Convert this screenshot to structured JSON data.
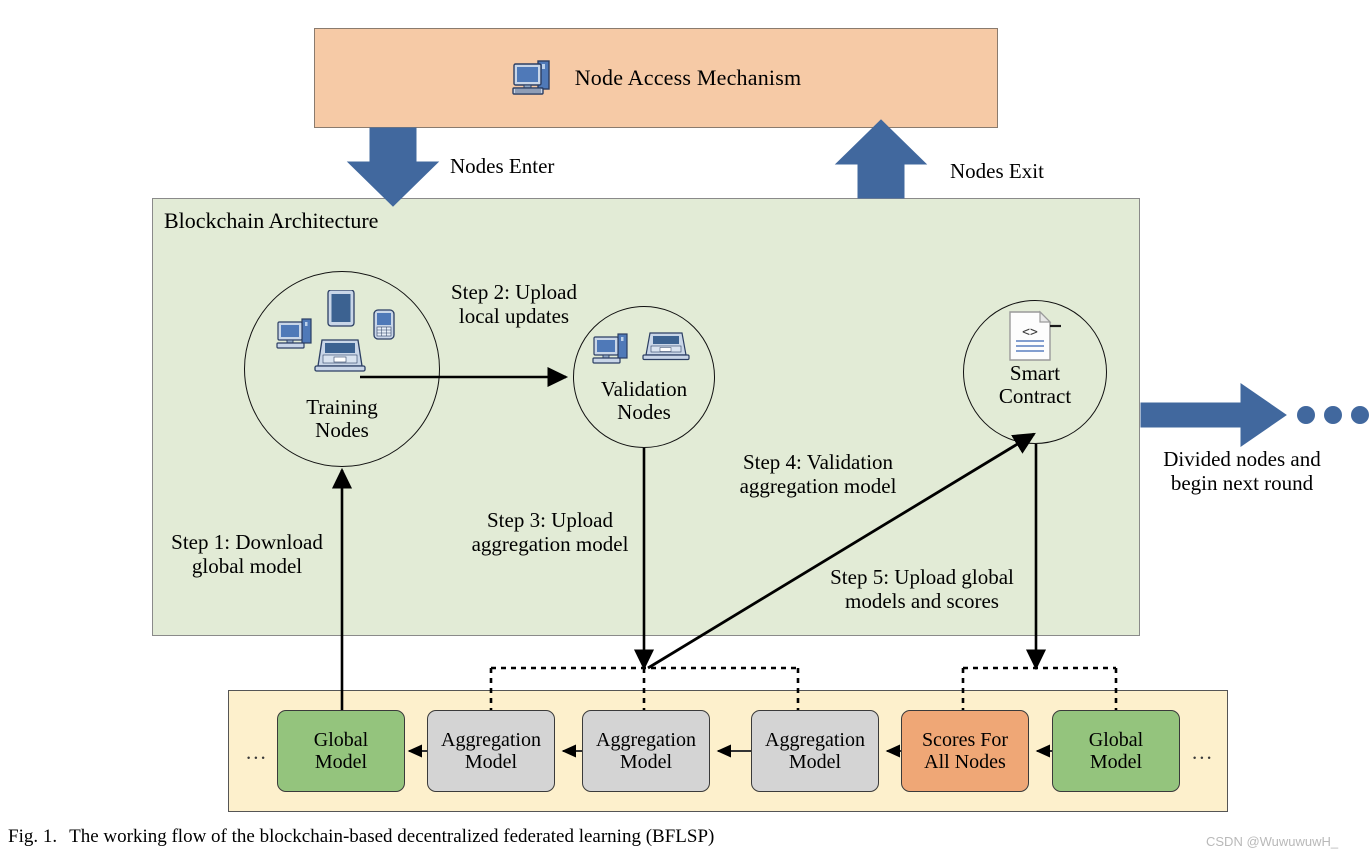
{
  "figure": {
    "caption_prefix": "Fig. 1.",
    "caption_text": "The working flow of the blockchain-based decentralized federated learning (BFLSP)",
    "watermark": "CSDN @WuwuwuwH_"
  },
  "node_access": {
    "label": "Node Access Mechanism",
    "icon": "desktop-computer-icon",
    "fill": "#F6CAA6",
    "border": "#8A7B6E"
  },
  "flow_arrows": {
    "enter_label": "Nodes Enter",
    "exit_label": "Nodes Exit",
    "next_round_label_line1": "Divided nodes and",
    "next_round_label_line2": "begin next round",
    "arrow_color": "#41689E"
  },
  "blockchain": {
    "title": "Blockchain Architecture",
    "fill": "#E2EBD6",
    "border": "#8A8A8A",
    "circles": [
      {
        "name": "training-nodes",
        "caption_line1": "Training",
        "caption_line2": "Nodes",
        "icons": [
          "desktop-computer-icon",
          "tablet-icon",
          "mobile-phone-icon",
          "laptop-icon"
        ]
      },
      {
        "name": "validation-nodes",
        "caption_line1": "Validation",
        "caption_line2": "Nodes",
        "icons": [
          "desktop-computer-icon",
          "laptop-icon"
        ]
      },
      {
        "name": "smart-contract",
        "caption_line1": "Smart",
        "caption_line2": "Contract",
        "icons": [
          "code-document-icon"
        ]
      }
    ]
  },
  "steps": [
    {
      "id": "step1",
      "line1": "Step 1: Download",
      "line2": "global model"
    },
    {
      "id": "step2",
      "line1": "Step 2: Upload",
      "line2": "local updates"
    },
    {
      "id": "step3",
      "line1": "Step 3: Upload",
      "line2": "aggregation model"
    },
    {
      "id": "step4",
      "line1": "Step 4: Validation",
      "line2": "aggregation model"
    },
    {
      "id": "step5",
      "line1": "Step 5: Upload global",
      "line2": "models and scores"
    }
  ],
  "ledger": {
    "fill": "#FDF0CC",
    "border": "#555555",
    "left_ellipsis": "...",
    "right_ellipsis": "...",
    "boxes": [
      {
        "line1": "Global",
        "line2": "Model",
        "kind": "green",
        "color": "#94C47D"
      },
      {
        "line1": "Aggregation",
        "line2": "Model",
        "kind": "gray",
        "color": "#D4D4D4"
      },
      {
        "line1": "Aggregation",
        "line2": "Model",
        "kind": "gray",
        "color": "#D4D4D4"
      },
      {
        "line1": "Aggregation",
        "line2": "Model",
        "kind": "gray",
        "color": "#D4D4D4"
      },
      {
        "line1": "Scores For",
        "line2": "All Nodes",
        "kind": "orange",
        "color": "#EFA776"
      },
      {
        "line1": "Global",
        "line2": "Model",
        "kind": "green",
        "color": "#94C47D"
      }
    ]
  }
}
